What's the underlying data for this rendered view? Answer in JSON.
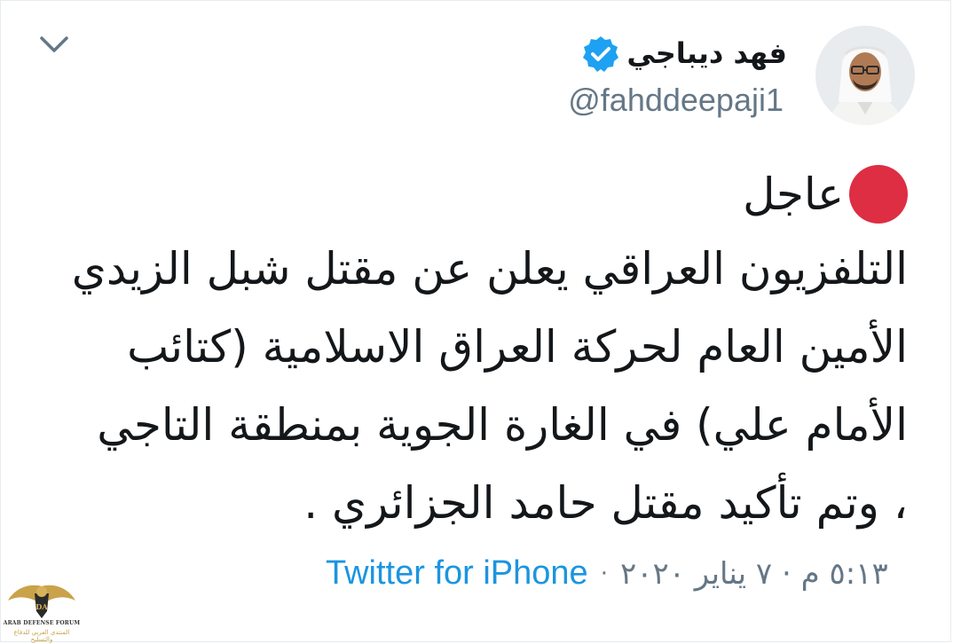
{
  "tweet": {
    "author": {
      "display_name": "فهد ديباجي",
      "handle": "@fahddeepaji1",
      "verified": true
    },
    "urgent_label": "عاجل",
    "lines": [
      "التلفزيون العراقي يعلن عن مقتل شبل الزيدي",
      "الأمين العام لحركة العراق الاسلامية (كتائب",
      "الأمام علي) في الغارة الجوية بمنطقة التاجي",
      "، وتم تأكيد مقتل حامد  الجزائري ."
    ],
    "timestamp": "٥:١٣ م · ٧ يناير ٢٠٢٠",
    "separator": "·",
    "source": "Twitter for iPhone"
  },
  "icons": {
    "menu": "chevron-down-icon",
    "verified": "verified-badge-icon",
    "urgent": "red-circle-icon"
  },
  "colors": {
    "text": "#14171a",
    "muted": "#657786",
    "link": "#1b95e0",
    "verified": "#1da1f2",
    "urgent_dot": "#dd2e44"
  },
  "watermark": {
    "line1": "ARAB DEFENSE FORUM",
    "line2": "المنتدى العربي للدفاع والتسليح"
  }
}
